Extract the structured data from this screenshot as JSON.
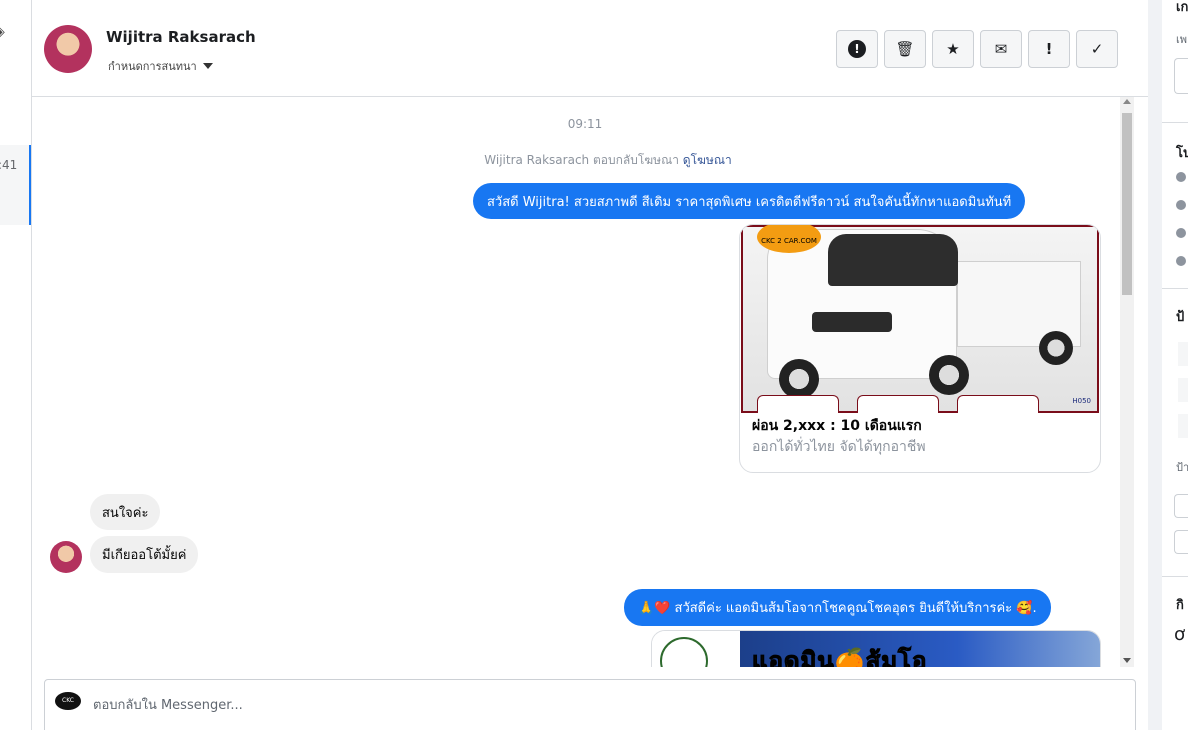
{
  "left": {
    "conversation_time": ":41"
  },
  "header": {
    "contact_name": "Wijitra Raksarach",
    "assign_label": "กำหนดการสนทนา",
    "actions": [
      "!",
      "🗑",
      "★",
      "✉",
      "!",
      "✓"
    ]
  },
  "thread": {
    "time": "09:11",
    "ad_reply_text": "Wijitra Raksarach ตอบกลับโฆษณา",
    "ad_reply_link": "ดูโฆษณา",
    "msg1": "สวัสดี Wijitra! สวยสภาพดี สีเดิม ราคาสุดพิเศษ เครดิตดีฟรีดาวน์  สนใจคันนี้ทักหาแอดมินทันที",
    "ad": {
      "logo_text": "CKC 2 CAR.COM",
      "code": "H050",
      "title": "ผ่อน 2,xxx : 10 เดือนแรก",
      "subtitle": "ออกได้ทั่วไทย จัดได้ทุกอาชีพ"
    },
    "in1": "สนใจค่ะ",
    "in2": "มีเกียออโต้มั้ยค่",
    "msg2": "🙏❤️ สวัสดีค่ะ แอดมินส้มโอจากโชคคูณโชคอุดร ยินดีให้บริการค่ะ 🥰.",
    "ad2_text": "แอดมิน🍊ส้มโอ"
  },
  "composer": {
    "page_logo": "CKC",
    "placeholder": "ตอบกลับใน Messenger..."
  },
  "right": {
    "t1": "เก",
    "t2": "เพ",
    "t3": "โป",
    "t4": "ป้",
    "t5": "ป้า",
    "t6": "กิ",
    "t7": "ơ"
  },
  "colors": {
    "accent": "#1877f2",
    "bubble_in": "#f0f0f0"
  }
}
